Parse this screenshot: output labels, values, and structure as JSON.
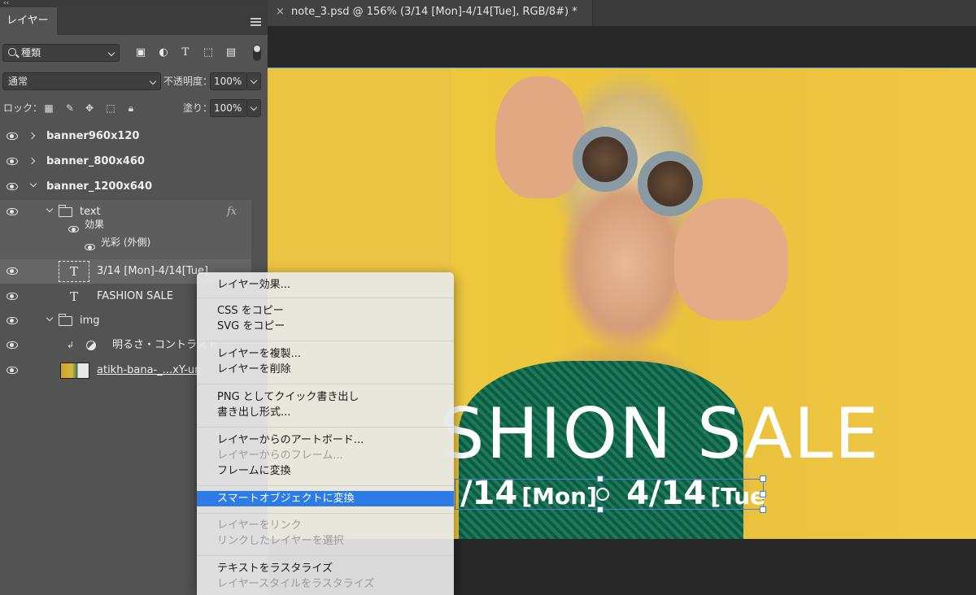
{
  "panel": {
    "collapse_glyph": "‹‹",
    "tab_label": "レイヤー",
    "filter": {
      "value": "種類",
      "icons": [
        "image-filter-icon",
        "adjustment-filter-icon",
        "type-filter-icon",
        "shape-filter-icon",
        "smart-object-filter-icon"
      ]
    },
    "blend_mode": "通常",
    "opacity_label": "不透明度：",
    "opacity_value": "100%",
    "lock_label": "ロック：",
    "fill_label": "塗り：",
    "fill_value": "100%"
  },
  "layers": [
    {
      "name": "banner960x120",
      "type": "artboard",
      "expanded": false
    },
    {
      "name": "banner_800x460",
      "type": "artboard",
      "expanded": false
    },
    {
      "name": "banner_1200x640",
      "type": "artboard",
      "expanded": true
    },
    {
      "name": "text",
      "type": "group",
      "fx": "fx"
    },
    {
      "name": "効果",
      "type": "effects"
    },
    {
      "name": "光彩 (外側)",
      "type": "effect"
    },
    {
      "name": "3/14 [Mon]-4/14[Tue]",
      "type": "text",
      "selected": true
    },
    {
      "name": "FASHION SALE",
      "type": "text"
    },
    {
      "name": "img",
      "type": "group"
    },
    {
      "name": "明るさ・コントラスト",
      "type": "adjustment"
    },
    {
      "name": "atikh-bana-_...xY-un",
      "type": "smart-object"
    }
  ],
  "document": {
    "close_glyph": "×",
    "title": "note_3.psd @ 156% (3/14 [Mon]-4/14[Tue], RGB/8#) *",
    "headline": "SHION SALE",
    "date_parts": [
      "/14",
      "[Mon]",
      "4/14",
      "[Tue"
    ]
  },
  "context_menu": {
    "items": [
      {
        "label": "レイヤー効果...",
        "enabled": true
      },
      {
        "label": "CSS をコピー",
        "enabled": true
      },
      {
        "label": "SVG をコピー",
        "enabled": true
      },
      {
        "label": "レイヤーを複製...",
        "enabled": true
      },
      {
        "label": "レイヤーを削除",
        "enabled": true
      },
      {
        "label": "PNG としてクイック書き出し",
        "enabled": true
      },
      {
        "label": "書き出し形式...",
        "enabled": true
      },
      {
        "label": "レイヤーからのアートボード...",
        "enabled": true
      },
      {
        "label": "レイヤーからのフレーム...",
        "enabled": false
      },
      {
        "label": "フレームに変換",
        "enabled": true
      },
      {
        "label": "スマートオブジェクトに変換",
        "enabled": true,
        "highlighted": true
      },
      {
        "label": "レイヤーをリンク",
        "enabled": false
      },
      {
        "label": "リンクしたレイヤーを選択",
        "enabled": false
      },
      {
        "label": "テキストをラスタライズ",
        "enabled": true
      },
      {
        "label": "レイヤースタイルをラスタライズ",
        "enabled": false
      }
    ]
  },
  "colors": {
    "panel_bg": "#535353",
    "menu_highlight": "#2d7be5",
    "canvas_yellow": "#ecc53b",
    "selection_blue": "#4a7fd0"
  }
}
